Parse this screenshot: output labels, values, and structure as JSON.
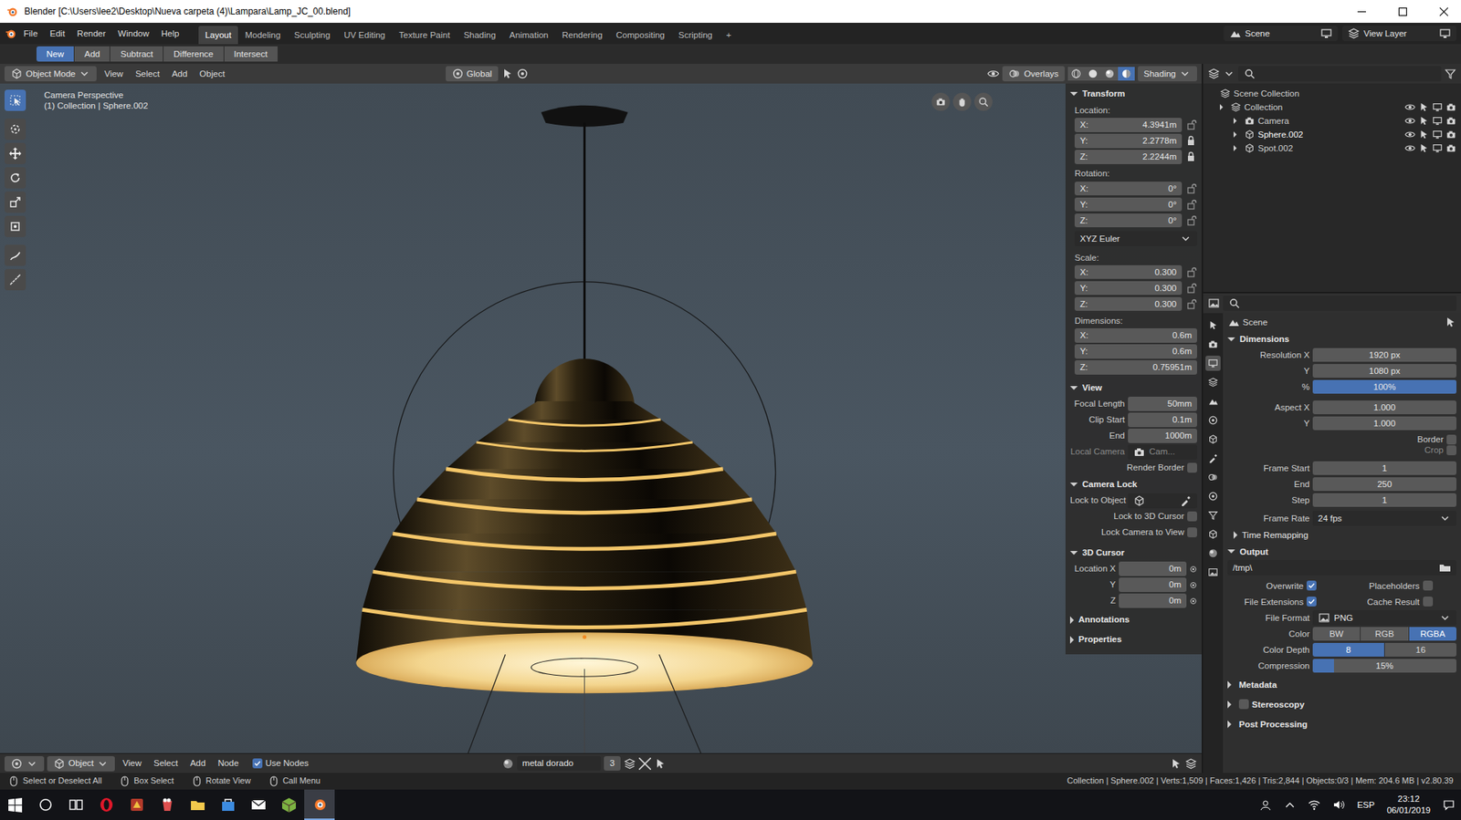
{
  "window": {
    "title": "Blender [C:\\Users\\lee2\\Desktop\\Nueva carpeta (4)\\Lampara\\Lamp_JC_00.blend]"
  },
  "menu": [
    "File",
    "Edit",
    "Render",
    "Window",
    "Help"
  ],
  "workspaces": [
    {
      "label": "Layout",
      "selected": true
    },
    {
      "label": "Modeling",
      "selected": false
    },
    {
      "label": "Sculpting",
      "selected": false
    },
    {
      "label": "UV Editing",
      "selected": false
    },
    {
      "label": "Texture Paint",
      "selected": false
    },
    {
      "label": "Shading",
      "selected": false
    },
    {
      "label": "Animation",
      "selected": false
    },
    {
      "label": "Rendering",
      "selected": false
    },
    {
      "label": "Compositing",
      "selected": false
    },
    {
      "label": "Scripting",
      "selected": false
    }
  ],
  "workspace_add": "+",
  "scene": "Scene",
  "view_layer": "View Layer",
  "tool_modes": [
    {
      "label": "New",
      "selected": true
    },
    {
      "label": "Add",
      "selected": false
    },
    {
      "label": "Subtract",
      "selected": false
    },
    {
      "label": "Difference",
      "selected": false
    },
    {
      "label": "Intersect",
      "selected": false
    }
  ],
  "viewport": {
    "mode": "Object Mode",
    "menus": [
      "View",
      "Select",
      "Add",
      "Object"
    ],
    "orientation": "Global",
    "overlays": "Overlays",
    "shading": "Shading",
    "shading_modes": [
      {
        "kind": "wireframe",
        "selected": false
      },
      {
        "kind": "solid",
        "selected": false
      },
      {
        "kind": "material",
        "selected": false
      },
      {
        "kind": "rendered",
        "selected": true
      }
    ],
    "info": [
      "Camera Perspective",
      "(1) Collection | Sphere.002"
    ],
    "toolbar": [
      {
        "kind": "select",
        "selected": true
      },
      {
        "kind": "cursor",
        "selected": false
      },
      {
        "kind": "move",
        "selected": false
      },
      {
        "kind": "rotate",
        "selected": false
      },
      {
        "kind": "scale",
        "selected": false
      },
      {
        "kind": "transform",
        "selected": false
      },
      {
        "kind": "annotate",
        "selected": false
      },
      {
        "kind": "measure",
        "selected": false
      }
    ]
  },
  "sidebar": {
    "transform": {
      "title": "Transform",
      "expanded": true,
      "location_label": "Location:",
      "location": [
        {
          "axis": "X:",
          "value": "4.3941m",
          "locked": false
        },
        {
          "axis": "Y:",
          "value": "2.2778m",
          "locked": true
        },
        {
          "axis": "Z:",
          "value": "2.2244m",
          "locked": true
        }
      ],
      "rotation_label": "Rotation:",
      "rotation": [
        {
          "axis": "X:",
          "value": "0°",
          "locked": false
        },
        {
          "axis": "Y:",
          "value": "0°",
          "locked": false
        },
        {
          "axis": "Z:",
          "value": "0°",
          "locked": false
        }
      ],
      "rotation_mode": "XYZ Euler",
      "scale_label": "Scale:",
      "scale": [
        {
          "axis": "X:",
          "value": "0.300",
          "locked": false
        },
        {
          "axis": "Y:",
          "value": "0.300",
          "locked": false
        },
        {
          "axis": "Z:",
          "value": "0.300",
          "locked": false
        }
      ],
      "dimensions_label": "Dimensions:",
      "dimensions": [
        {
          "axis": "X:",
          "value": "0.6m"
        },
        {
          "axis": "Y:",
          "value": "0.6m"
        },
        {
          "axis": "Z:",
          "value": "0.75951m"
        }
      ]
    },
    "view": {
      "title": "View",
      "expanded": true,
      "fields": [
        {
          "label": "Focal Length",
          "value": "50mm"
        },
        {
          "label": "Clip Start",
          "value": "0.1m"
        },
        {
          "label": "End",
          "value": "1000m"
        }
      ],
      "local_camera": {
        "label": "Local Camera",
        "value": "Cam..."
      },
      "render_border": {
        "label": "Render Border",
        "checked": false
      }
    },
    "camera_lock": {
      "title": "Camera Lock",
      "expanded": true,
      "lock_to_object": "Lock to Object",
      "checks": [
        {
          "label": "Lock to 3D Cursor",
          "checked": false
        },
        {
          "label": "Lock Camera to View",
          "checked": false
        }
      ]
    },
    "cursor": {
      "title": "3D Cursor",
      "expanded": true,
      "fields": [
        {
          "label": "Location X",
          "value": "0m"
        },
        {
          "label": "Y",
          "value": "0m"
        },
        {
          "label": "Z",
          "value": "0m"
        }
      ]
    },
    "collapsed": [
      {
        "title": "Annotations",
        "expanded": false
      },
      {
        "title": "Properties",
        "expanded": false
      }
    ]
  },
  "outliner": {
    "items": [
      {
        "label": "Scene Collection",
        "kind": "root",
        "selected": false
      },
      {
        "label": "Collection",
        "kind": "collection",
        "selected": false
      },
      {
        "label": "Camera",
        "kind": "object",
        "selected": false
      },
      {
        "label": "Sphere.002",
        "kind": "object",
        "selected": true
      },
      {
        "label": "Spot.002",
        "kind": "object",
        "selected": false
      }
    ]
  },
  "properties": {
    "context": "Scene",
    "tabs": [
      {
        "kind": "tool",
        "selected": false
      },
      {
        "kind": "render",
        "selected": false
      },
      {
        "kind": "output",
        "selected": true
      },
      {
        "kind": "view_layer",
        "selected": false
      },
      {
        "kind": "scene",
        "selected": false
      },
      {
        "kind": "world",
        "selected": false
      },
      {
        "kind": "object",
        "selected": false
      },
      {
        "kind": "modifiers",
        "selected": false
      },
      {
        "kind": "particles",
        "selected": false
      },
      {
        "kind": "physics",
        "selected": false
      },
      {
        "kind": "constraints",
        "selected": false
      },
      {
        "kind": "data",
        "selected": false
      },
      {
        "kind": "material",
        "selected": false
      },
      {
        "kind": "texture",
        "selected": false
      }
    ],
    "dimensions": {
      "title": "Dimensions",
      "expanded": true,
      "fields": [
        {
          "label": "Resolution X",
          "value": "1920 px"
        },
        {
          "label": "Y",
          "value": "1080 px"
        },
        {
          "label": "%",
          "value": "100%",
          "level": 1
        }
      ],
      "aspect": [
        {
          "label": "Aspect X",
          "value": "1.000"
        },
        {
          "label": "Y",
          "value": "1.000"
        }
      ],
      "border": {
        "label": "Border",
        "checked": false
      },
      "crop": {
        "label": "Crop",
        "checked": false,
        "disabled": true
      },
      "frames": [
        {
          "label": "Frame Start",
          "value": "1"
        },
        {
          "label": "End",
          "value": "250"
        },
        {
          "label": "Step",
          "value": "1"
        }
      ],
      "frame_rate": {
        "label": "Frame Rate",
        "value": "24 fps"
      },
      "time_remapping": {
        "title": "Time Remapping",
        "expanded": false
      }
    },
    "output": {
      "title": "Output",
      "expanded": true,
      "path": "/tmp\\",
      "checks": [
        {
          "label": "Overwrite",
          "checked": true
        },
        {
          "label": "Placeholders",
          "checked": false
        },
        {
          "label": "File Extensions",
          "checked": true
        },
        {
          "label": "Cache Result",
          "checked": false
        }
      ],
      "file_format": {
        "label": "File Format",
        "value": "PNG"
      },
      "color": {
        "label": "Color",
        "options": [
          {
            "label": "BW",
            "selected": false
          },
          {
            "label": "RGB",
            "selected": false
          },
          {
            "label": "RGBA",
            "selected": true
          }
        ]
      },
      "color_depth": {
        "label": "Color Depth",
        "options": [
          {
            "label": "8",
            "selected": true
          },
          {
            "label": "16",
            "selected": false
          }
        ]
      },
      "compression": {
        "label": "Compression",
        "value": "15%",
        "level": 0.15
      }
    },
    "collapsed": [
      {
        "title": "Metadata",
        "expanded": false
      },
      {
        "title": "Stereoscopy",
        "expanded": false,
        "checked": false
      },
      {
        "title": "Post Processing",
        "expanded": false
      }
    ]
  },
  "node_header": {
    "editor": "Object",
    "menus": [
      "View",
      "Select",
      "Add",
      "Node"
    ],
    "use_nodes": {
      "label": "Use Nodes",
      "checked": true
    },
    "material": "metal dorado",
    "users": "3"
  },
  "status_bar": {
    "hints": [
      "Select or Deselect All",
      "Box Select",
      "Rotate View",
      "Call Menu"
    ],
    "stats": "Collection | Sphere.002 | Verts:1,509 | Faces:1,426 | Tris:2,844 | Objects:0/3 | Mem: 204.6 MB | v2.80.39"
  },
  "taskbar": {
    "language": "ESP",
    "time": "23:12",
    "date": "06/01/2019"
  }
}
